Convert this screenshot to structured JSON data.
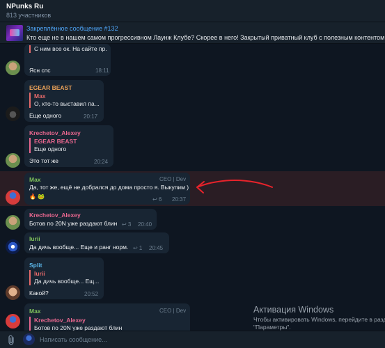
{
  "header": {
    "title": "NPunks Ru",
    "subtitle": "813 участников"
  },
  "pinned": {
    "title": "Закреплённое сообщение #132",
    "text": "Кто еще не в нашем самом прогрессивном Лаунж Клубе? Скорее в него!  Закрытый приватный клуб с полезным контентом, Airdrops"
  },
  "messages": [
    {
      "reply_text": "С ним все ок. На сайте пр...",
      "text": "Ясн спс",
      "time": "18:11"
    },
    {
      "author": "EGEAR BEAST",
      "reply_author": "Max",
      "reply_text": "О, кто-то выставил па...",
      "text": "Еще одного",
      "time": "20:17"
    },
    {
      "author": "Krechetov_Alexey",
      "reply_author": "EGEAR BEAST",
      "reply_text": "Еще одного",
      "text": "Это тот же",
      "time": "20:24"
    },
    {
      "author": "Max",
      "role": "CEO | Dev",
      "text": "Да, тот же, ещё не добрался до дома просто я. Выкупим )",
      "reactions": "🔥 🐸",
      "replies": "↩ 6",
      "time": "20:37"
    },
    {
      "author": "Krechetov_Alexey",
      "text": "Ботов по 20N уже раздают блин",
      "replies": "↩ 3",
      "time": "20:40"
    },
    {
      "author": "Iurii",
      "text": "Да дичь вообще... Еще и ранг норм.",
      "replies": "↩ 1",
      "time": "20:45"
    },
    {
      "author": "Split",
      "reply_author": "Iurii",
      "reply_text": "Да дичь вообще... Ещ...",
      "text": "Какой?",
      "time": "20:52"
    },
    {
      "author": "Max",
      "role": "CEO | Dev",
      "reply_author": "Krechetov_Alexey",
      "reply_text": "Ботов по 20N уже раздают блин"
    }
  ],
  "watermark": {
    "title": "Активация Windows",
    "line1": "Чтобы активировать Windows, перейдите в раздел",
    "line2": "\"Параметры\"."
  },
  "composer": {
    "placeholder": "Написать сообщение..."
  },
  "colors": {
    "bg": "#0e1621",
    "bubble": "#182533",
    "accent": "#4ea4f6",
    "highlight": "#2a1d24",
    "arrow": "#e8232b"
  }
}
